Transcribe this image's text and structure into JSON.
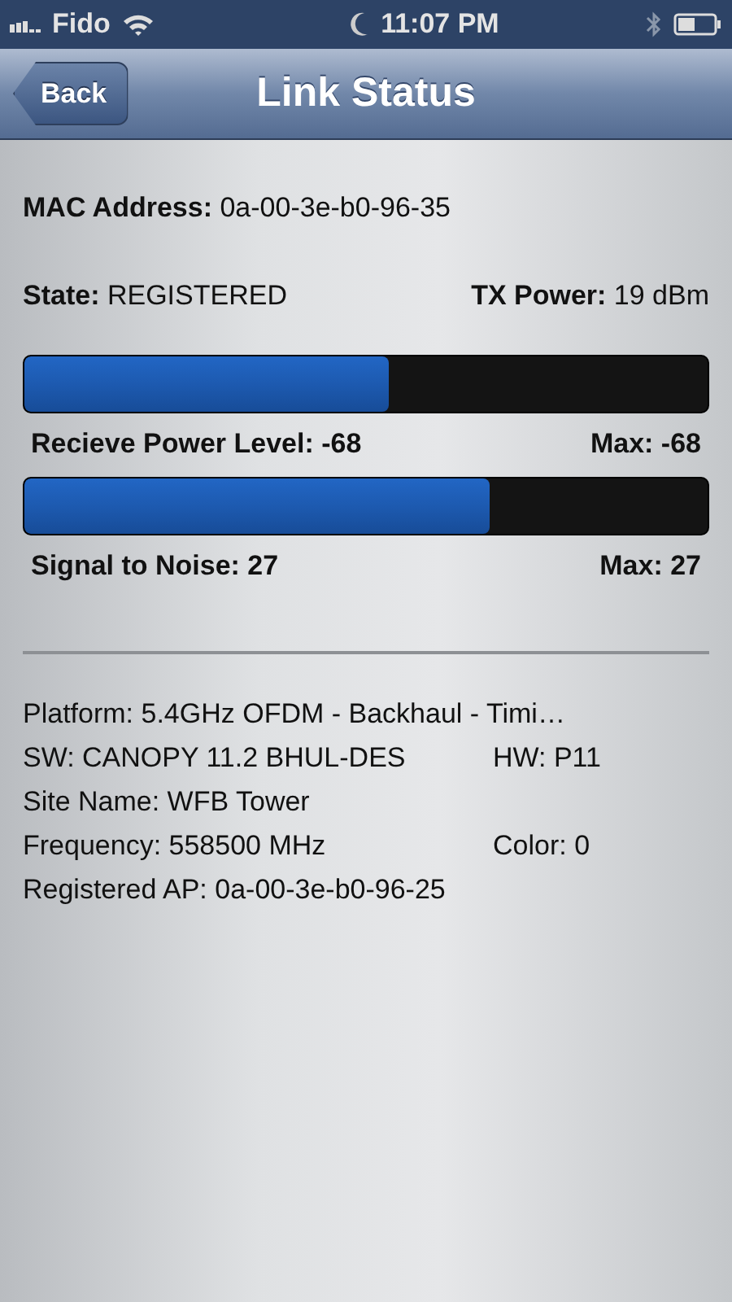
{
  "status_bar": {
    "carrier": "Fido",
    "time": "11:07 PM"
  },
  "nav_bar": {
    "back_button": "Back",
    "title": "Link Status"
  },
  "mac_address": "**MAC Address:** 0a-00-3e-b0-96-35",
  "state": "**State:** REGISTERED",
  "tx_power": "**TX Power:** 19 dBm",
  "meters": [
    {
      "level": 0.533,
      "label": "Recieve Power Level: -68",
      "max": "Max: -68"
    },
    {
      "level": 0.68,
      "label": "Signal to Noise: 27",
      "max": "Max: 27"
    }
  ],
  "info_rows": [
    {
      "left": "Platform: 5.4GHz OFDM - Backhaul - Timi…"
    },
    {
      "left": "SW: CANOPY 11.2 BHUL-DES",
      "right": "HW: P11"
    },
    {
      "left": "Site Name: WFB Tower"
    },
    {
      "left": "Frequency: 558500 MHz",
      "right": "Color: 0"
    },
    {
      "left": "Registered AP: 0a-00-3e-b0-96-25"
    }
  ]
}
